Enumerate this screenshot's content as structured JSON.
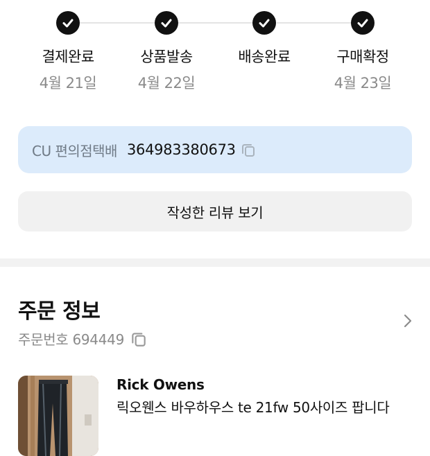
{
  "steps": [
    {
      "label": "결제완료",
      "date": "4월 21일"
    },
    {
      "label": "상품발송",
      "date": "4월 22일"
    },
    {
      "label": "배송완료",
      "date": ""
    },
    {
      "label": "구매확정",
      "date": "4월 23일"
    }
  ],
  "tracking": {
    "carrier": "CU 편의점택배",
    "number": "364983380673"
  },
  "review_button": "작성한 리뷰 보기",
  "order": {
    "title": "주문 정보",
    "number_label": "주문번호 694449",
    "product": {
      "brand": "Rick Owens",
      "name": "릭오웬스 바우하우스 te 21fw 50사이즈 팝니다"
    }
  },
  "colors": {
    "tracking_bg": "#dcebfb",
    "step_done": "#111111",
    "muted": "#8a8a8a"
  },
  "icons": [
    "check-icon",
    "copy-icon",
    "chevron-right-icon"
  ]
}
